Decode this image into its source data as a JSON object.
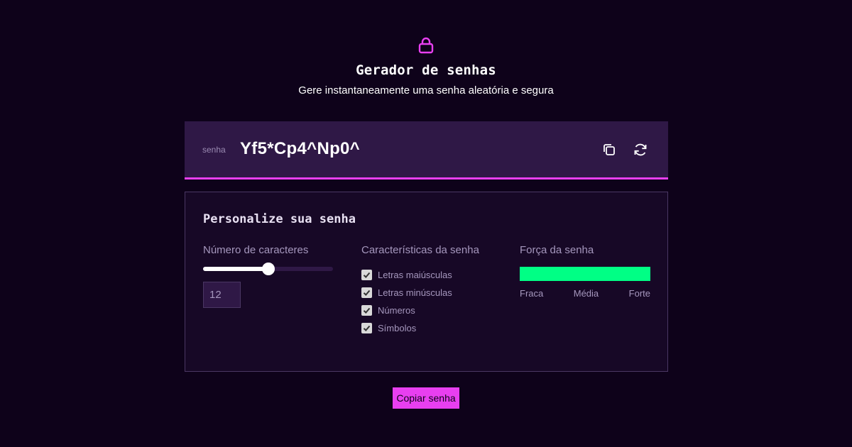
{
  "header": {
    "icon": "lock-icon",
    "title": "Gerador de senhas",
    "subtitle": "Gere instantaneamente uma senha aleatória e segura"
  },
  "password": {
    "label": "senha",
    "value": "Yf5*Cp4^Np0^",
    "copy_icon": "copy-icon",
    "refresh_icon": "refresh-icon"
  },
  "panel": {
    "title": "Personalize sua senha",
    "length": {
      "label": "Número de caracteres",
      "value": "12",
      "slider_fraction": 0.5
    },
    "characteristics": {
      "label": "Características da senha",
      "options": [
        {
          "label": "Letras maiúsculas",
          "checked": true
        },
        {
          "label": "Letras minúsculas",
          "checked": true
        },
        {
          "label": "Números",
          "checked": true
        },
        {
          "label": "Símbolos",
          "checked": true
        }
      ]
    },
    "strength": {
      "label": "Força da senha",
      "level_fraction": 1.0,
      "levels": [
        "Fraca",
        "Média",
        "Forte"
      ]
    }
  },
  "copy_button": {
    "label": "Copiar senha"
  },
  "colors": {
    "background": "#0e021a",
    "accent": "#e83ff0",
    "strong": "#00ff85",
    "panel": "#170826",
    "bar": "#2f1846"
  }
}
